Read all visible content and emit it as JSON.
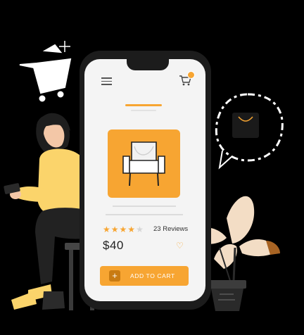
{
  "product": {
    "rating_value": 4,
    "rating_max": 5,
    "reviews_label": "23 Reviews",
    "price": "$40",
    "add_to_cart_label": "ADD TO CART",
    "add_icon_glyph": "+",
    "wishlist_icon_glyph": "♡"
  },
  "colors": {
    "accent": "#f7a532",
    "accent_dark": "#c97b12",
    "phone_frame": "#1c1c1c",
    "screen_bg": "#f4f4f4",
    "page_bg": "#000000"
  },
  "icons": {
    "menu": "hamburger-menu-icon",
    "cart": "shopping-cart-icon",
    "wishlist": "heart-icon",
    "product": "armchair-icon",
    "add": "plus-icon"
  }
}
